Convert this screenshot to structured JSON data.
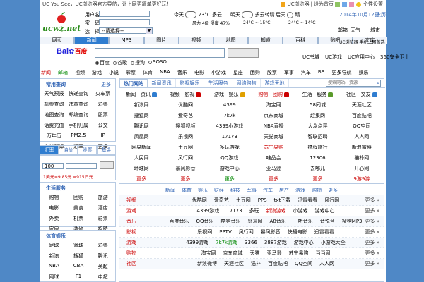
{
  "topbar": {
    "title": "UC You See，UC浏览器官方导航，让上网更简单更好玩！",
    "right_links": [
      "UC浏览器",
      "设为首页"
    ],
    "settings": "个性设置"
  },
  "header": {
    "logo_text": "ucwz.net",
    "form": {
      "label1": "用户名",
      "label2": "密　码",
      "label3": "选　择",
      "select_value": "--请选择--"
    },
    "weather": {
      "w1": {
        "label": "今天",
        "temp": "23°C 多云",
        "detail": "风力 4级  湿度 47%"
      },
      "w2": {
        "label": "明天",
        "desc": "多云转晴",
        "range": "24°C ~ 15°C"
      },
      "w3": {
        "label": "后天",
        "desc": "晴",
        "range": "24°C ~ 14°C"
      }
    },
    "date": "2014年10月12日",
    "date_link": "农历",
    "right_icons": [
      "邮箱",
      "天气",
      "城市"
    ]
  },
  "tabs": [
    "网页",
    "新闻",
    "MP3",
    "图片",
    "视频",
    "地图",
    "知道",
    "百科",
    "贴吧",
    "文库"
  ],
  "active_tab": 1,
  "search": {
    "logo_part1": "Bai",
    "logo_part2": "百度",
    "button": "百度一下",
    "radios": [
      "百度",
      "谷歌",
      "搜狗",
      "SOSO"
    ],
    "right_links": [
      "UC书城",
      "UC游戏",
      "UC应用中心",
      "360安全卫士"
    ],
    "top_right": "UC浏览器·手机上网首选"
  },
  "navrow": [
    "新闻",
    "邮箱",
    "视频",
    "游戏",
    "小说",
    "彩票",
    "体育",
    "NBA",
    "音乐",
    "电影",
    "小游戏",
    "星座",
    "团购",
    "股票",
    "军事",
    "汽车",
    "BB",
    "更多导航",
    "娱乐"
  ],
  "left_panel1": {
    "title": "常用查询",
    "more": "更多",
    "items": [
      "天气预报",
      "快递查询",
      "火车票",
      "机票查询",
      "违章查询",
      "彩票",
      "地图查询",
      "邮编查询",
      "股票",
      "话费充值",
      "手机归属",
      "公交",
      "万年历",
      "PM2.5",
      "IP",
      "在线翻译",
      "汇率",
      "更多"
    ]
  },
  "left_tabs": [
    "汇率",
    "油价",
    "股票",
    "基金"
  ],
  "converter": {
    "amount": "100",
    "button": "换算",
    "result": "1美元=9.85元 =915日元"
  },
  "left_panel2": {
    "title": "生活服务",
    "items": [
      "购物",
      "团购",
      "旅游",
      "电影",
      "美食",
      "酒店",
      "外卖",
      "机票",
      "彩票",
      "家居",
      "装修",
      "招聘"
    ]
  },
  "left_panel3": {
    "title": "体育娱乐",
    "items": [
      "足球",
      "篮球",
      "彩票",
      "新浪",
      "搜狐",
      "腾讯",
      "NBA",
      "CBA",
      "英超",
      "网球",
      "F1",
      "中超"
    ]
  },
  "main_tabs": [
    "热门网站",
    "新闻资讯",
    "影视娱乐",
    "生活服务",
    "网络购物",
    "游戏天地"
  ],
  "main_search_placeholder": "搜索网站、资源",
  "main_cats": [
    "新闻 · 资讯",
    "视频 · 影视",
    "游戏 · 娱乐",
    "购物 · 团购",
    "生活 · 服务",
    "社区 · 交友"
  ],
  "main_rows": [
    [
      "新浪网",
      "优酷网",
      "4399",
      "淘宝网",
      "58同城",
      "天涯社区"
    ],
    [
      "搜狐网",
      "爱奇艺",
      "7k7k",
      "京东商城",
      "赶集网",
      "百度贴吧"
    ],
    [
      "腾讯网",
      "搜狐视频",
      "4399小游戏",
      "NBA直播",
      "大众点评",
      "QQ空间"
    ],
    [
      "凤凰网",
      "乐视网",
      "17173",
      "天猫商城",
      "智联招聘",
      "人人网"
    ],
    [
      "网易新闻",
      "土豆网",
      "多玩游戏",
      "苏宁易购",
      "携程旅行",
      "新浪微博"
    ],
    [
      "人民网",
      "风行网",
      "QQ游戏",
      "唯品会",
      "12306",
      "猫扑网"
    ],
    [
      "环球网",
      "暴风影音",
      "游戏中心",
      "亚马逊",
      "去哪儿",
      "开心网"
    ],
    [
      "更多",
      "更多",
      "更多",
      "更多",
      "更多",
      "9游9游"
    ]
  ],
  "main_links": [
    "新闻",
    "体育",
    "娱乐",
    "财经",
    "科技",
    "军事",
    "汽车",
    "房产",
    "游戏",
    "购物",
    "更多"
  ],
  "rows": [
    {
      "cat": "视频",
      "items": [
        "优酷网",
        "爱奇艺",
        "土豆网",
        "PPS",
        "txt下载",
        "迅雷看看",
        "风行网"
      ],
      "more": "更多 »"
    },
    {
      "cat": "游戏",
      "items": [
        "4399游戏",
        "17173",
        "多玩",
        "新浪游戏",
        "小游戏",
        "游戏中心"
      ],
      "more": "更多 »"
    },
    {
      "cat": "音乐",
      "items": [
        "百度音乐",
        "QQ音乐",
        "酷狗音乐",
        "虾米网",
        "A8音乐",
        "一听音乐",
        "音悦台",
        "搜狗MP3"
      ],
      "more": "更多 »"
    },
    {
      "cat": "影视",
      "items": [
        "乐视网",
        "PPTV",
        "风行网",
        "暴风影音",
        "快播电影",
        "迅雷看看"
      ],
      "more": "更多 »"
    },
    {
      "cat": "游戏",
      "items": [
        "4399游戏",
        "7k7k游戏",
        "3366",
        "3887游戏",
        "游戏中心",
        "小游戏大全"
      ],
      "more": "更多 »"
    },
    {
      "cat": "购物",
      "items": [
        "淘宝网",
        "京东商城",
        "天猫",
        "亚马逊",
        "苏宁易购",
        "当当网"
      ],
      "more": "更多 »"
    },
    {
      "cat": "社区",
      "items": [
        "新浪微博",
        "天涯社区",
        "猫扑",
        "百度贴吧",
        "QQ空间",
        "人人网"
      ],
      "more": "更多 »"
    }
  ],
  "colors": {
    "brand": "#2f7dd0",
    "side": "#4f88c6",
    "accent_red": "#c00"
  }
}
